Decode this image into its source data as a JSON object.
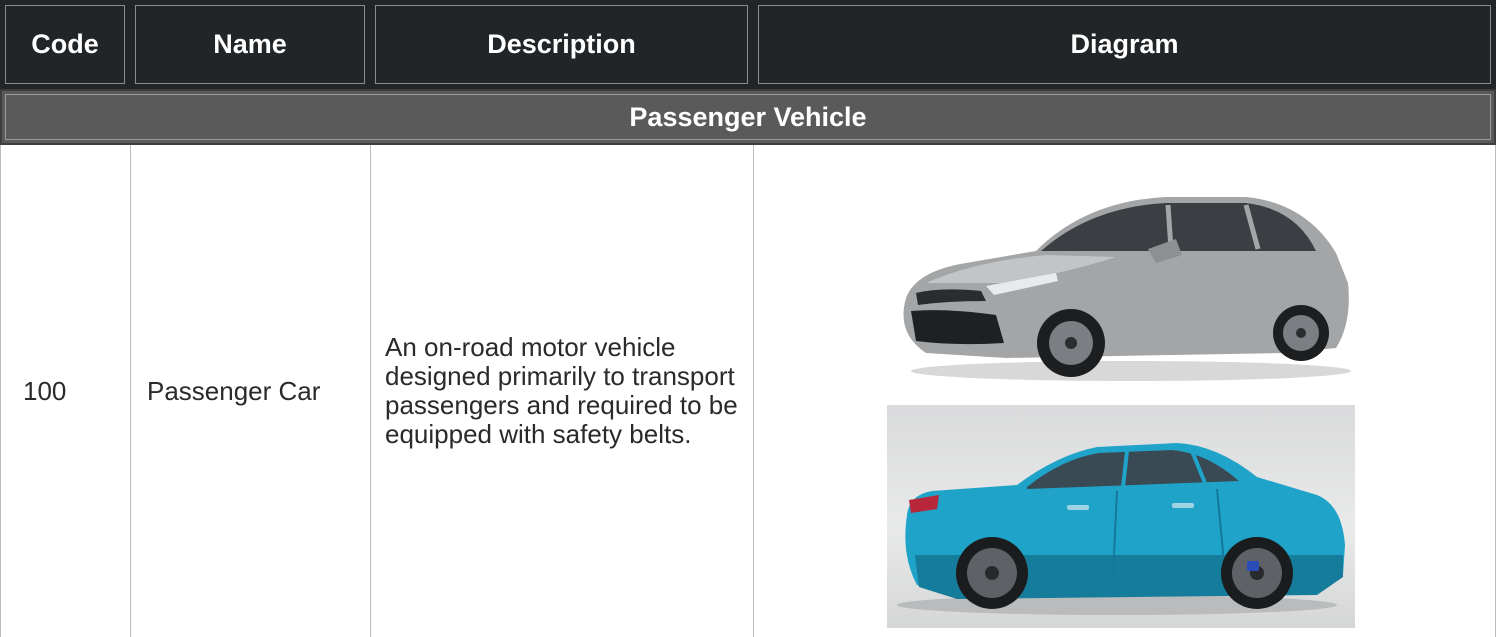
{
  "table": {
    "headers": [
      "Code",
      "Name",
      "Description",
      "Diagram"
    ],
    "category": "Passenger Vehicle",
    "rows": [
      {
        "code": "100",
        "name": "Passenger Car",
        "description": "An on-road motor vehicle designed primarily to transport passengers and required to be equipped with safety belts.",
        "diagram_images": [
          "silver-sedan-front-three-quarter",
          "blue-sedan-side-profile"
        ]
      }
    ]
  },
  "colors": {
    "header_bg": "#212527",
    "category_bg": "#5a5a5a",
    "silver_car": "#9c9ea0",
    "blue_car": "#1fa3c9"
  }
}
